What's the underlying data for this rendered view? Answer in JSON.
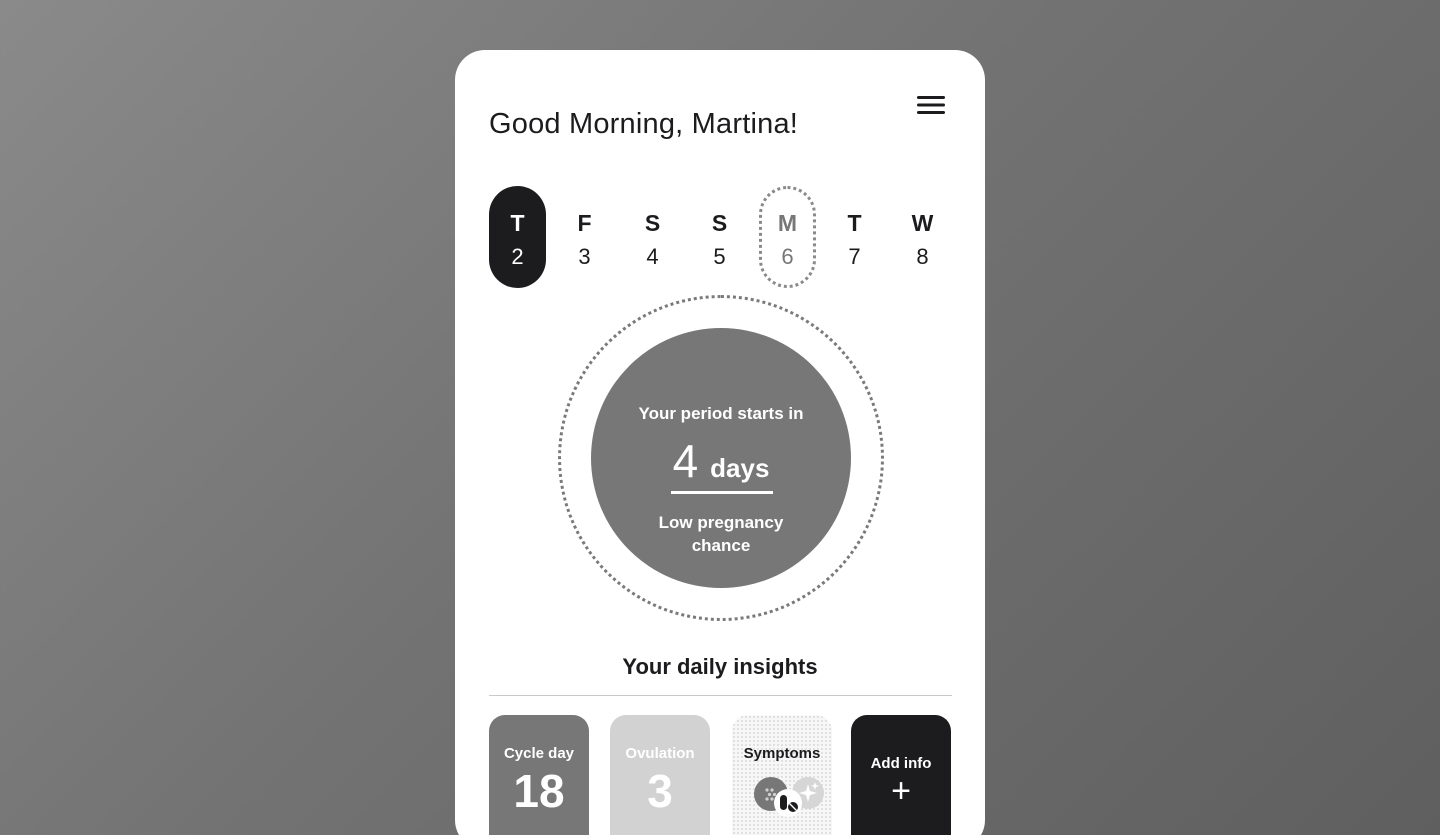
{
  "header": {
    "greeting": "Good Morning, Martina!",
    "menu_icon": "hamburger-menu-icon"
  },
  "week": {
    "selected_index": 0,
    "today_index": 4,
    "days": [
      {
        "letter": "T",
        "number": "2"
      },
      {
        "letter": "F",
        "number": "3"
      },
      {
        "letter": "S",
        "number": "4"
      },
      {
        "letter": "S",
        "number": "5"
      },
      {
        "letter": "M",
        "number": "6"
      },
      {
        "letter": "T",
        "number": "7"
      },
      {
        "letter": "W",
        "number": "8"
      }
    ]
  },
  "period": {
    "prefix": "Your period starts in",
    "count": "4",
    "unit": "days",
    "chance": "Low pregnancy chance"
  },
  "insights": {
    "title": "Your daily insights",
    "cycle_label": "Cycle day",
    "cycle_value": "18",
    "ovulation_label": "Ovulation",
    "ovulation_value": "3",
    "symptoms_label": "Symptoms",
    "symptom_icons": [
      "mood-icon",
      "pill-icon",
      "sparkle-icon"
    ],
    "add_label": "Add info",
    "add_symbol": "+"
  },
  "colors": {
    "dark": "#1c1c1f",
    "mid_gray": "#777777",
    "light_gray": "#d2d2d2",
    "card": "#ffffff"
  }
}
